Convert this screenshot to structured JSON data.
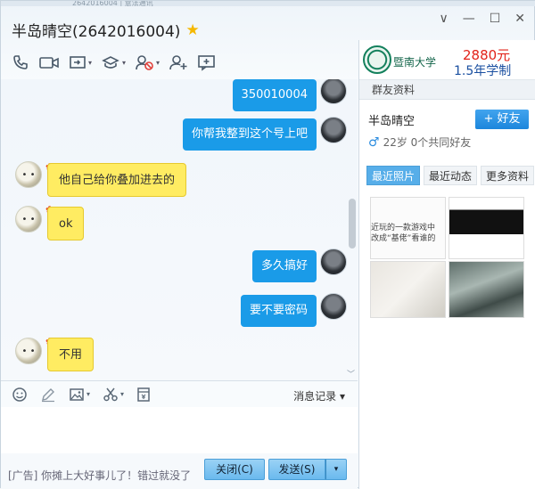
{
  "window": {
    "tab_fragment": "2642016004 | 意法通讯",
    "title": "半岛晴空(2642016004)",
    "controls": [
      "∨",
      "—",
      "☐",
      "✕"
    ]
  },
  "toolbar": {
    "icons": [
      "phone-icon",
      "video-icon",
      "remote-desktop-icon",
      "apps-icon",
      "block-icon",
      "add-friend-icon",
      "comment-icon"
    ]
  },
  "messages": [
    {
      "side": "right",
      "text": "350010004"
    },
    {
      "side": "right",
      "text": "你帮我整到这个号上吧"
    },
    {
      "side": "left",
      "text": "他自己给你叠加进去的"
    },
    {
      "side": "left",
      "text": "ok"
    },
    {
      "side": "right",
      "text": "多久搞好"
    },
    {
      "side": "right",
      "text": "要不要密码"
    },
    {
      "side": "left",
      "text": "不用"
    }
  ],
  "input_toolbar": {
    "history_label": "消息记录",
    "history_arrow": "▾"
  },
  "bottom": {
    "ad_text": "[广告] 你摊上大好事儿了！错过就没了",
    "close_label": "关闭(C)",
    "send_label": "发送(S)",
    "send_arrow": "▾"
  },
  "side_ad": {
    "school": "暨南大学",
    "price": "2880元",
    "duration": "1.5年学制"
  },
  "profile": {
    "section_title": "群友资料",
    "name": "半岛晴空",
    "add_friend_label": "+ 好友",
    "info": "22岁 0个共同好友",
    "tabs": [
      "最近照片",
      "最近动态",
      "更多资料"
    ],
    "photo_caption": "近玩的一款游戏中\n改成“基佬”看谁的"
  },
  "colors": {
    "bubble_right": "#1a9be8",
    "bubble_left": "#ffec62",
    "accent": "#1c86dc"
  }
}
